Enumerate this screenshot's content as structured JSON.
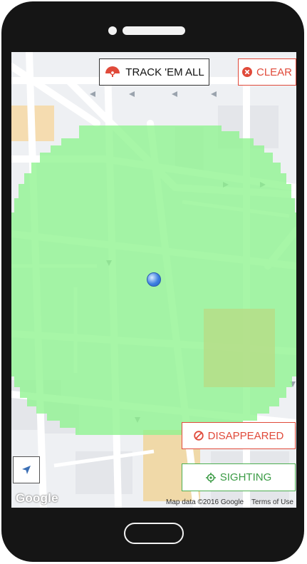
{
  "toolbar": {
    "track_label": "TRACK 'EM ALL",
    "clear_label": "CLEAR"
  },
  "actions": {
    "disappeared_label": "DISAPPEARED",
    "sighting_label": "SIGHTING"
  },
  "map": {
    "google_logo": "Google",
    "attribution": "Map data ©2016 Google",
    "terms": "Terms of Use"
  },
  "colors": {
    "accent_red": "#e04a3a",
    "accent_green": "#4caf50",
    "radius_fill": "#8ef38e",
    "location_dot": "#3c7fe0"
  },
  "icons": [
    "pokeball-umbrella-icon",
    "close-circle-icon",
    "block-icon",
    "crosshair-icon",
    "navigation-arrow-icon"
  ]
}
